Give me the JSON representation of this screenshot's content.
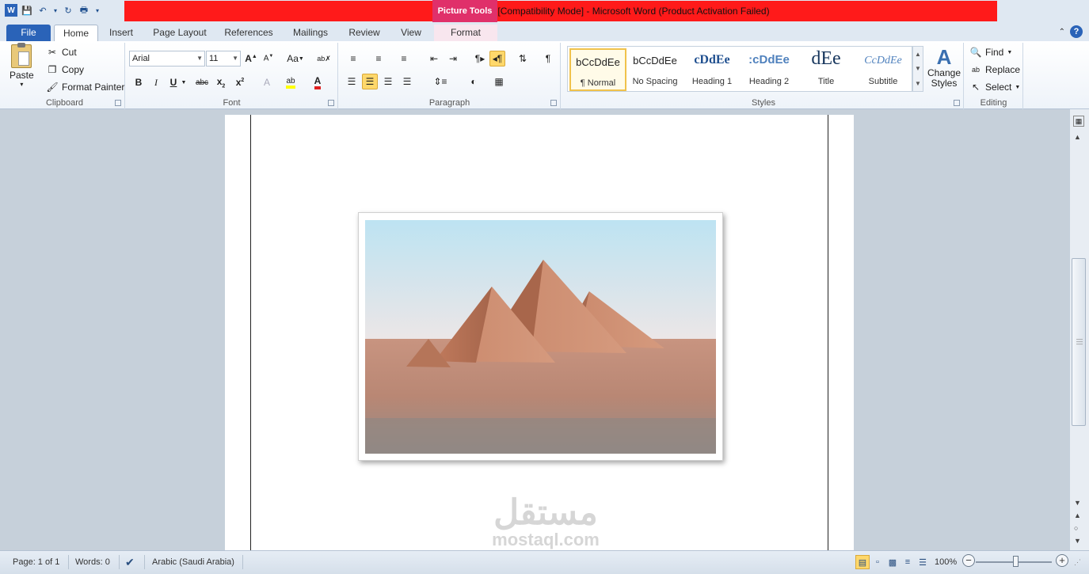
{
  "title_bar": {
    "title": "عطبي [Compatibility Mode]  -  Microsoft Word (Product Activation Failed)",
    "contextual_tab": "Picture Tools",
    "qat_icons": [
      "word-logo-icon",
      "save-icon",
      "undo-icon",
      "redo-icon",
      "print-preview-icon",
      "customize-qat-icon"
    ]
  },
  "tabs": {
    "file": "File",
    "home": "Home",
    "insert": "Insert",
    "page_layout": "Page Layout",
    "references": "References",
    "mailings": "Mailings",
    "review": "Review",
    "view": "View",
    "format": "Format"
  },
  "clipboard": {
    "paste": "Paste",
    "cut": "Cut",
    "copy": "Copy",
    "format_painter": "Format Painter",
    "label": "Clipboard"
  },
  "font": {
    "name": "Arial",
    "size": "11",
    "label": "Font",
    "change_case": "Aa"
  },
  "paragraph": {
    "label": "Paragraph"
  },
  "styles": {
    "label": "Styles",
    "items": [
      {
        "sample": "bCcDdEe",
        "name": "¶ Normal"
      },
      {
        "sample": "bCcDdEe",
        "name": "No Spacing"
      },
      {
        "sample": "cDdEe",
        "name": "Heading 1"
      },
      {
        "sample": ":cDdEe",
        "name": "Heading 2"
      },
      {
        "sample": "dEe",
        "name": "Title"
      },
      {
        "sample": "CcDdEe",
        "name": "Subtitle"
      }
    ],
    "change_styles": "Change Styles"
  },
  "editing": {
    "find": "Find",
    "replace": "Replace",
    "select": "Select",
    "label": "Editing"
  },
  "document": {
    "watermark_arabic": "مستقل",
    "watermark_latin": "mostaql.com"
  },
  "status_bar": {
    "page": "Page: 1 of 1",
    "words": "Words: 0",
    "language": "Arabic (Saudi Arabia)",
    "zoom": "100%"
  }
}
